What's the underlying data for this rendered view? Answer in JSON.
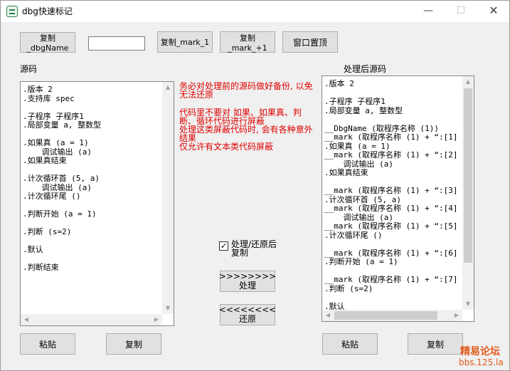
{
  "window": {
    "title": "dbg快速标记",
    "controls": {
      "minimize": "—",
      "maximize": "☐",
      "close": "✕"
    }
  },
  "toolbar": {
    "copy_dbgname": "复制_dbgName",
    "input_value": "",
    "copy_mark_1": "复制_mark_1",
    "copy_mark_plus1": "复制_mark_+1",
    "window_topmost": "窗口置顶"
  },
  "source": {
    "label": "源码",
    "lines": [
      ".版本 2",
      ".支持库 spec",
      "",
      ".子程序 子程序1",
      ".局部变量 a, 整数型",
      "",
      ".如果真 (a = 1)",
      "    调试输出 (a)",
      ".如果真结束",
      "",
      ".计次循环首 (5, a)",
      "    调试输出 (a)",
      ".计次循环尾 ()",
      "",
      ".判断开始 (a = 1)",
      "",
      ".判断 (s=2)",
      "",
      ".默认",
      "",
      ".判断结束"
    ]
  },
  "notes": {
    "backup_warning": "务必对处理前的源码做好备份, 以免\n无法还原",
    "rules": "代码里不要对 如果、如果真、判\n断、循环代码进行屏蔽\n处理这类屏蔽代码时, 会有各种意外\n结果\n仅允许有文本类代码屏蔽"
  },
  "options": {
    "copy_after_process_label": "处理/还原后\n复制",
    "copy_after_process_checked": true
  },
  "actions": {
    "process": ">>>>>>>>\n处理",
    "restore": "<<<<<<<<\n还原"
  },
  "processed": {
    "label": "处理后源码",
    "lines": [
      ".版本 2",
      "",
      ".子程序 子程序1",
      ".局部变量 a, 整数型",
      "",
      "__DbgName (取程序名称 (1))",
      "__mark (取程序名称 (1) + “:[1]",
      ".如果真 (a = 1)",
      "__mark (取程序名称 (1) + “:[2]",
      "    调试输出 (a)",
      ".如果真结束",
      "",
      "__mark (取程序名称 (1) + “:[3]",
      ".计次循环首 (5, a)",
      "__mark (取程序名称 (1) + “:[4]",
      "    调试输出 (a)",
      "__mark (取程序名称 (1) + “:[5]",
      ".计次循环尾 ()",
      "",
      "__mark (取程序名称 (1) + “:[6]",
      ".判断开始 (a = 1)",
      "",
      "__mark (取程序名称 (1) + “:[7]",
      ".判断 (s=2)",
      "",
      ".默认"
    ]
  },
  "bottom": {
    "paste_left": "粘贴",
    "copy_left": "复制",
    "paste_right": "粘贴",
    "copy_right": "复制"
  },
  "watermark": {
    "logo": "精易论坛",
    "url": "bbs.125.la"
  },
  "colors": {
    "warning_red": "#e00000",
    "watermark_orange": "#e05a1c"
  }
}
